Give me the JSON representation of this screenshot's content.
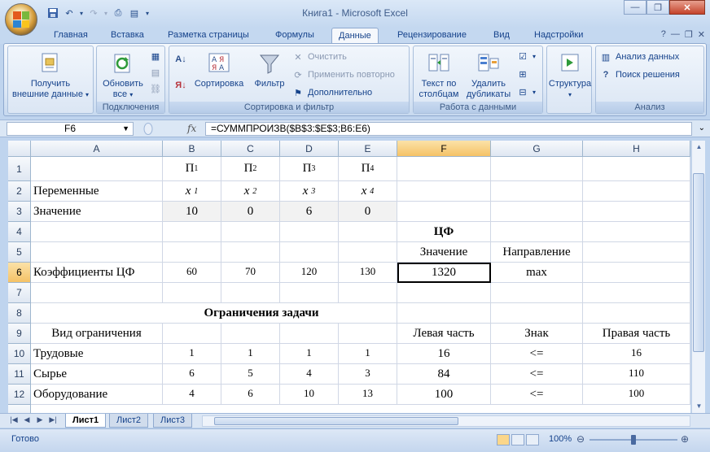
{
  "window": {
    "title": "Книга1 - Microsoft Excel",
    "min_icon": "minimize-icon",
    "max_icon": "restore-icon",
    "close_icon": "close-icon"
  },
  "ribbon_tabs": [
    "Главная",
    "Вставка",
    "Разметка страницы",
    "Формулы",
    "Данные",
    "Рецензирование",
    "Вид",
    "Надстройки"
  ],
  "active_tab": "Данные",
  "groups": {
    "get_external": {
      "btn1": "Получить",
      "btn2": "внешние данные",
      "label": ""
    },
    "connections": {
      "refresh1": "Обновить",
      "refresh2": "все",
      "label": "Подключения"
    },
    "sort_filter": {
      "sort": "Сортировка",
      "filter": "Фильтр",
      "clear": "Очистить",
      "reapply": "Применить повторно",
      "advanced": "Дополнительно",
      "label": "Сортировка и фильтр"
    },
    "data_tools": {
      "text1": "Текст по",
      "text2": "столбцам",
      "dup1": "Удалить",
      "dup2": "дубликаты",
      "label": "Работа с данными"
    },
    "outline": {
      "btn": "Структура",
      "label": ""
    },
    "analysis": {
      "data_analysis": "Анализ данных",
      "solver": "Поиск решения",
      "label": "Анализ"
    }
  },
  "formula_bar": {
    "name_box": "F6",
    "fx": "fx",
    "formula": "=СУММПРОИЗВ($B$3:$E$3;B6:E6)"
  },
  "columns": [
    "A",
    "B",
    "C",
    "D",
    "E",
    "F",
    "G",
    "H"
  ],
  "rows": [
    "1",
    "2",
    "3",
    "4",
    "5",
    "6",
    "7",
    "8",
    "9",
    "10",
    "11",
    "12"
  ],
  "cells": {
    "b1": "П",
    "b1s": "1",
    "c1": "П",
    "c1s": "2",
    "d1": "П",
    "d1s": "3",
    "e1": "П",
    "e1s": "4",
    "a2": "Переменные",
    "b2": "x",
    "b2s": "1",
    "c2": "x",
    "c2s": "2",
    "d2": "x",
    "d2s": "3",
    "e2": "x",
    "e2s": "4",
    "a3": "Значение",
    "b3": "10",
    "c3": "0",
    "d3": "6",
    "e3": "0",
    "f4": "ЦФ",
    "f5": "Значение",
    "g5": "Направление",
    "a6": "Коэффициенты ЦФ",
    "b6": "60",
    "c6": "70",
    "d6": "120",
    "e6": "130",
    "f6": "1320",
    "g6": "max",
    "a8": "Ограничения задачи",
    "a9": "Вид ограничения",
    "f9": "Левая часть",
    "g9": "Знак",
    "h9": "Правая часть",
    "a10": "Трудовые",
    "b10": "1",
    "c10": "1",
    "d10": "1",
    "e10": "1",
    "f10": "16",
    "g10": "<=",
    "h10": "16",
    "a11": "Сырье",
    "b11": "6",
    "c11": "5",
    "d11": "4",
    "e11": "3",
    "f11": "84",
    "g11": "<=",
    "h11": "110",
    "a12": "Оборудование",
    "b12": "4",
    "c12": "6",
    "d12": "10",
    "e12": "13",
    "f12": "100",
    "g12": "<=",
    "h12": "100"
  },
  "sheets": [
    "Лист1",
    "Лист2",
    "Лист3"
  ],
  "active_sheet": "Лист1",
  "status": {
    "ready": "Готово",
    "zoom": "100%"
  },
  "colors": {
    "accent": "#15428b",
    "selected_header": "#f5c266"
  }
}
